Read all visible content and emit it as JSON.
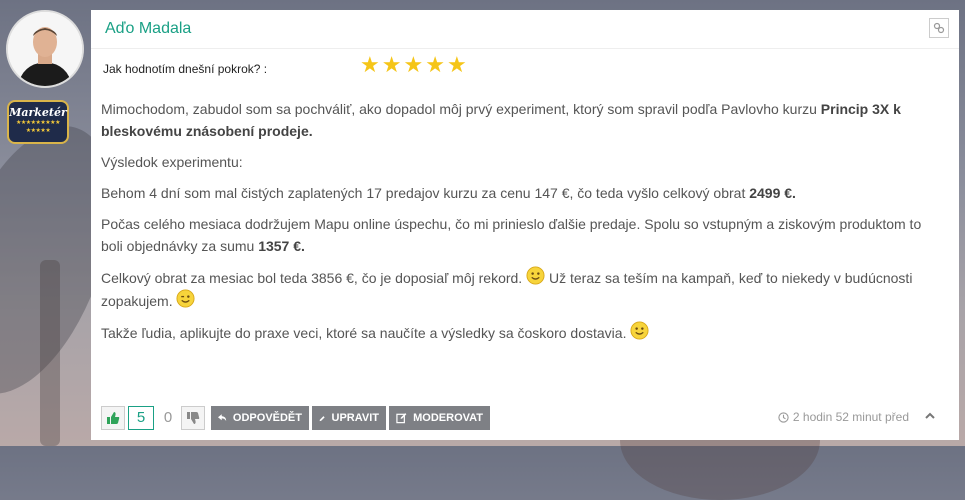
{
  "author": {
    "name": "Aďo Madala"
  },
  "badge": {
    "label": "Marketér",
    "stars_row1": "★★★★★★★★★",
    "stars_row2": "★★★★★"
  },
  "rating": {
    "label": "Jak hodnotím dnešní pokrok? :",
    "value": 5,
    "max": 5
  },
  "post": {
    "p1_text": "Mimochodom, zabudol som sa pochváliť, ako dopadol môj prvý experiment, ktorý som spravil podľa Pavlovho kurzu ",
    "p1_bold": "Princip 3X k bleskovému znásobení prodeje.",
    "p2": "Výsledok experimentu:",
    "p3_text": "Behom 4 dní som mal čistých zaplatených 17 predajov kurzu za cenu 147 €, čo teda vyšlo celkový obrat ",
    "p3_bold": "2499 €.",
    "p4_text": "Počas celého mesiaca dodržujem Mapu online úspechu, čo mi prinieslo ďalšie predaje. Spolu so vstupným a ziskovým produktom to boli objednávky za sumu ",
    "p4_bold": "1357 €.",
    "p5_text1": "Celkový obrat za mesiac bol teda 3856 €, čo je doposiaľ môj rekord.",
    "p5_text2": " Už teraz sa teším na kampaň, keď to niekedy v budúcnosti zopakujem.",
    "p6_text": "Takže ľudia, aplikujte do praxe veci, ktoré sa naučíte a výsledky sa čoskoro dostavia."
  },
  "footer": {
    "likes": "5",
    "dislikes": "0",
    "reply_label": "ODPOVĚDĚT",
    "edit_label": "UPRAVIT",
    "moderate_label": "MODEROVAT",
    "timestamp": "2 hodin 52 minut před"
  },
  "colors": {
    "accent": "#1aa085",
    "star": "#f5c518",
    "button_bg": "#7e8085"
  }
}
